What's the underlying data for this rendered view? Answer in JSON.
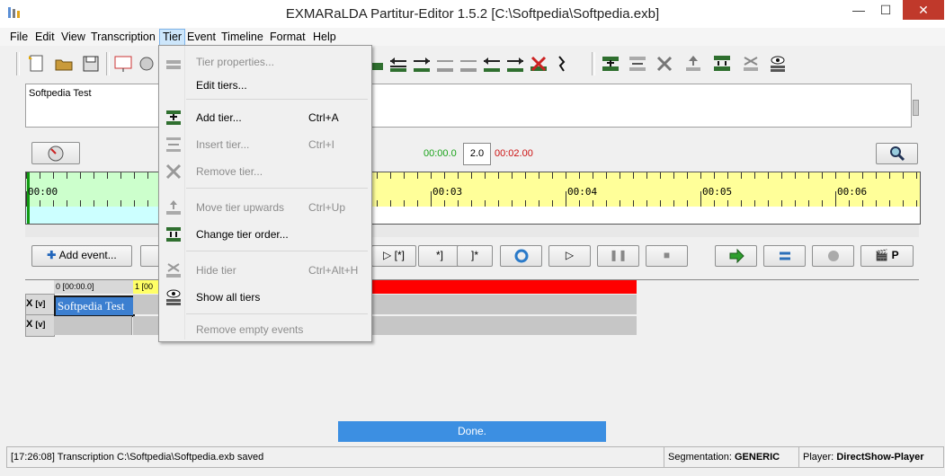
{
  "window": {
    "title": "EXMARaLDA Partitur-Editor 1.5.2 [C:\\Softpedia\\Softpedia.exb]",
    "minimize": "—",
    "maximize": "☐",
    "close": "✕"
  },
  "menubar": {
    "file": "File",
    "edit": "Edit",
    "view": "View",
    "transcription": "Transcription",
    "tier": "Tier",
    "event": "Event",
    "timeline": "Timeline",
    "format": "Format",
    "help": "Help"
  },
  "textpanel": {
    "content": "Softpedia Test"
  },
  "nav": {
    "start_time": "00:00.0",
    "step_value": "2.0",
    "end_time": "00:02.00"
  },
  "timeline": {
    "labels": [
      "00:00",
      "00:03",
      "00:04",
      "00:05",
      "00:06"
    ]
  },
  "controls": {
    "add_event": "Add event...",
    "bracket_star": "[*]",
    "star_bracket": "*]",
    "close_star": "]*",
    "p_label": "P"
  },
  "grid": {
    "col0_header": "0 [00:00.0]",
    "col1_header": "1 [00",
    "tier_x": "X",
    "tier_v": "[v]",
    "event_text": "Softpedia Test"
  },
  "status": {
    "done": "Done.",
    "message": "[17:26:08] Transcription C:\\Softpedia\\Softpedia.exb saved",
    "segmentation_label": "Segmentation:",
    "segmentation_value": "GENERIC",
    "player_label": "Player:",
    "player_value": "DirectShow-Player"
  },
  "tier_menu": {
    "tier_properties": "Tier properties...",
    "edit_tiers": "Edit tiers...",
    "add_tier": "Add tier...",
    "add_tier_sc": "Ctrl+A",
    "insert_tier": "Insert tier...",
    "insert_tier_sc": "Ctrl+I",
    "remove_tier": "Remove tier...",
    "move_tier_up": "Move tier upwards",
    "move_tier_up_sc": "Ctrl+Up",
    "change_tier_order": "Change tier order...",
    "hide_tier": "Hide tier",
    "hide_tier_sc": "Ctrl+Alt+H",
    "show_all_tiers": "Show all tiers",
    "remove_empty_events": "Remove empty events"
  },
  "colors": {
    "accent": "#3c8fe2",
    "timeline_yellow": "#ffff99",
    "timeline_green": "#ccffcc",
    "red_bar": "#ff0000",
    "green_time": "#1aa31a",
    "red_time": "#cc1111"
  }
}
